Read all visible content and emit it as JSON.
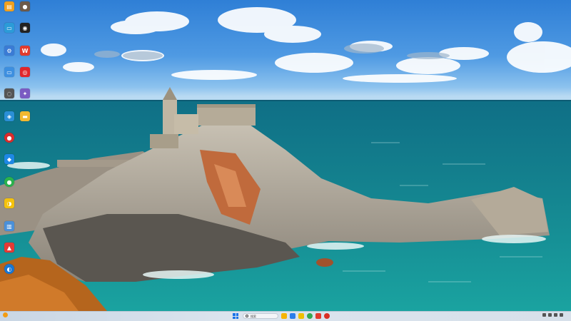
{
  "desktop": {
    "icons": [
      {
        "name": "desktop-icon-1",
        "label": "",
        "color": "#f0a020",
        "symbol": "▤"
      },
      {
        "name": "desktop-icon-2",
        "label": "",
        "color": "#6d5a4a",
        "symbol": "●"
      },
      {
        "name": "desktop-icon-3",
        "label": "",
        "color": "#2b9bd8",
        "symbol": "▭"
      },
      {
        "name": "desktop-icon-4",
        "label": "",
        "color": "#222222",
        "symbol": "◉"
      },
      {
        "name": "desktop-icon-5",
        "label": "",
        "color": "#3a7bd5",
        "symbol": "⚙"
      },
      {
        "name": "desktop-icon-6",
        "label": "",
        "color": "#e23b2e",
        "symbol": "W"
      },
      {
        "name": "desktop-icon-7",
        "label": "",
        "color": "#3d8fe0",
        "symbol": "▭"
      },
      {
        "name": "desktop-icon-8",
        "label": "",
        "color": "#e0262b",
        "symbol": "◎"
      },
      {
        "name": "desktop-icon-9",
        "label": "",
        "color": "#555555",
        "symbol": "◌"
      },
      {
        "name": "desktop-icon-10",
        "label": "",
        "color": "#7a5bc2",
        "symbol": "✦"
      },
      {
        "name": "desktop-icon-11",
        "label": "",
        "color": "#2a8fd6",
        "symbol": "◈"
      },
      {
        "name": "desktop-icon-12",
        "label": "",
        "color": "#f2b830",
        "symbol": "▬"
      },
      {
        "name": "desktop-icon-13",
        "label": "",
        "color": "#d92c2c",
        "symbol": "●"
      },
      {
        "name": "desktop-icon-14",
        "label": "",
        "color": "#1e88e5",
        "symbol": "◆"
      },
      {
        "name": "desktop-icon-15",
        "label": "",
        "color": "#2bb24c",
        "symbol": "●"
      },
      {
        "name": "desktop-icon-16",
        "label": "",
        "color": "#f4c20d",
        "symbol": "◑"
      },
      {
        "name": "desktop-icon-17",
        "label": "",
        "color": "#4a90d9",
        "symbol": "▥"
      },
      {
        "name": "desktop-icon-18",
        "label": "",
        "color": "#e53935",
        "symbol": "▲"
      },
      {
        "name": "desktop-icon-19",
        "label": "",
        "color": "#1976d2",
        "symbol": "◐"
      }
    ]
  },
  "taskbar": {
    "weather_temp": "",
    "weather_desc": "",
    "search_placeholder": "搜索",
    "apps": [
      {
        "name": "taskbar-app-1",
        "color": "#f5b400"
      },
      {
        "name": "taskbar-app-2",
        "color": "#2b7de9"
      },
      {
        "name": "taskbar-app-3",
        "color": "#f0c000"
      },
      {
        "name": "taskbar-app-4",
        "color": "#34a853"
      },
      {
        "name": "taskbar-app-5",
        "color": "#e23b2e"
      },
      {
        "name": "taskbar-app-6",
        "color": "#d93025"
      }
    ],
    "time": "",
    "date": ""
  }
}
